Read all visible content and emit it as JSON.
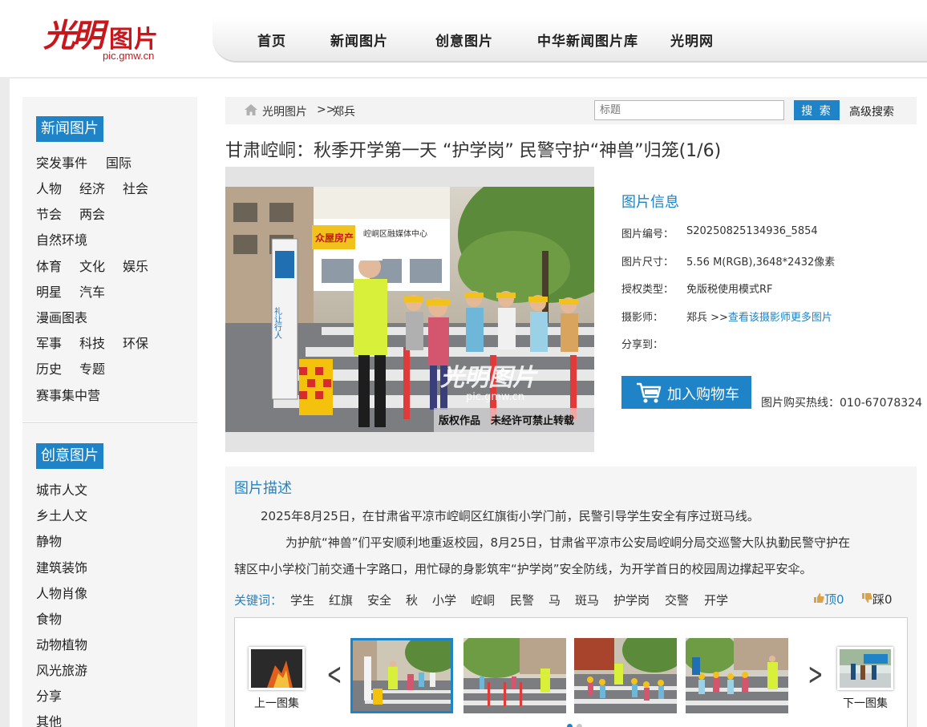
{
  "site": {
    "logo_mark": "光明",
    "logo_word": "图片",
    "logo_domain": "pic.gmw.cn"
  },
  "nav": {
    "items": [
      "首页",
      "新闻图片",
      "创意图片",
      "中华新闻图片库",
      "光明网"
    ]
  },
  "sidebar": {
    "news": {
      "title": "新闻图片",
      "rows": [
        [
          "突发事件",
          "国际"
        ],
        [
          "人物",
          "经济",
          "社会"
        ],
        [
          "节会",
          "两会"
        ],
        [
          "自然环境"
        ],
        [
          "体育",
          "文化",
          "娱乐"
        ],
        [
          "明星",
          "汽车"
        ],
        [
          "漫画图表"
        ],
        [
          "军事",
          "科技",
          "环保"
        ],
        [
          "历史",
          "专题"
        ],
        [
          "赛事集中营"
        ]
      ]
    },
    "creative": {
      "title": "创意图片",
      "items": [
        "城市人文",
        "乡土人文",
        "静物",
        "建筑装饰",
        "人物肖像",
        "食物",
        "动物植物",
        "风光旅游",
        "分享",
        "其他"
      ]
    }
  },
  "breadcrumb": {
    "home": "光明图片",
    "separator": ">>",
    "current": "郑兵"
  },
  "search": {
    "placeholder": "标题",
    "button": "搜 索",
    "advanced": "高级搜索"
  },
  "title": "甘肃崆峒：秋季开学第一天 “护学岗” 民警守护“神兽”归笼(1/6)",
  "photo": {
    "watermark_logo": "光明图片",
    "watermark_domain": "pic.gmw.cn",
    "copyright": "版权作品　未经许可禁止转载",
    "sign_text_1": "众屋房产",
    "sign_text_2": "崆峒区融媒体中心",
    "sign_text_3": "礼让行人"
  },
  "info": {
    "title": "图片信息",
    "fields": [
      {
        "label": "图片编号：",
        "value": "S20250825134936_5854"
      },
      {
        "label": "图片尺寸：",
        "value": "5.56 M(RGB),3648*2432像素"
      },
      {
        "label": "授权类型：",
        "value": "免版税使用模式RF"
      },
      {
        "label": "摄影师：",
        "value": "郑兵 >>"
      },
      {
        "label": "分享到：",
        "value": ""
      }
    ],
    "more_link": "查看该摄影师更多图片",
    "cart_button": "加入购物车",
    "hotline": "图片购买热线：010-67078324"
  },
  "description": {
    "title": "图片描述",
    "p1": "2025年8月25日，在甘肃省平凉市崆峒区红旗街小学门前，民警引导学生安全有序过斑马线。",
    "p2a": "为护航“神兽”们平安顺利地重返校园，8月25日，甘肃省平凉市公安局崆峒分局交巡警大队执勤民警守护在",
    "p2b": "辖区中小学校门前交通十字路口，用忙碌的身影筑牢“护学岗”安全防线，为开学首日的校园周边撑起平安伞。"
  },
  "keywords": {
    "label": "关键词：",
    "items": [
      "学生",
      "红旗",
      "安全",
      "秋",
      "小学",
      "崆峒",
      "民警",
      "马",
      "斑马",
      "护学岗",
      "交警",
      "开学"
    ]
  },
  "votes": {
    "up": "顶0",
    "down": "踩0"
  },
  "strip": {
    "prev_set": "上一图集",
    "next_set": "下一图集",
    "prev_arrow": "<",
    "next_arrow": ">"
  },
  "colors": {
    "accent": "#1e84c7",
    "brand_red": "#c8161d"
  }
}
